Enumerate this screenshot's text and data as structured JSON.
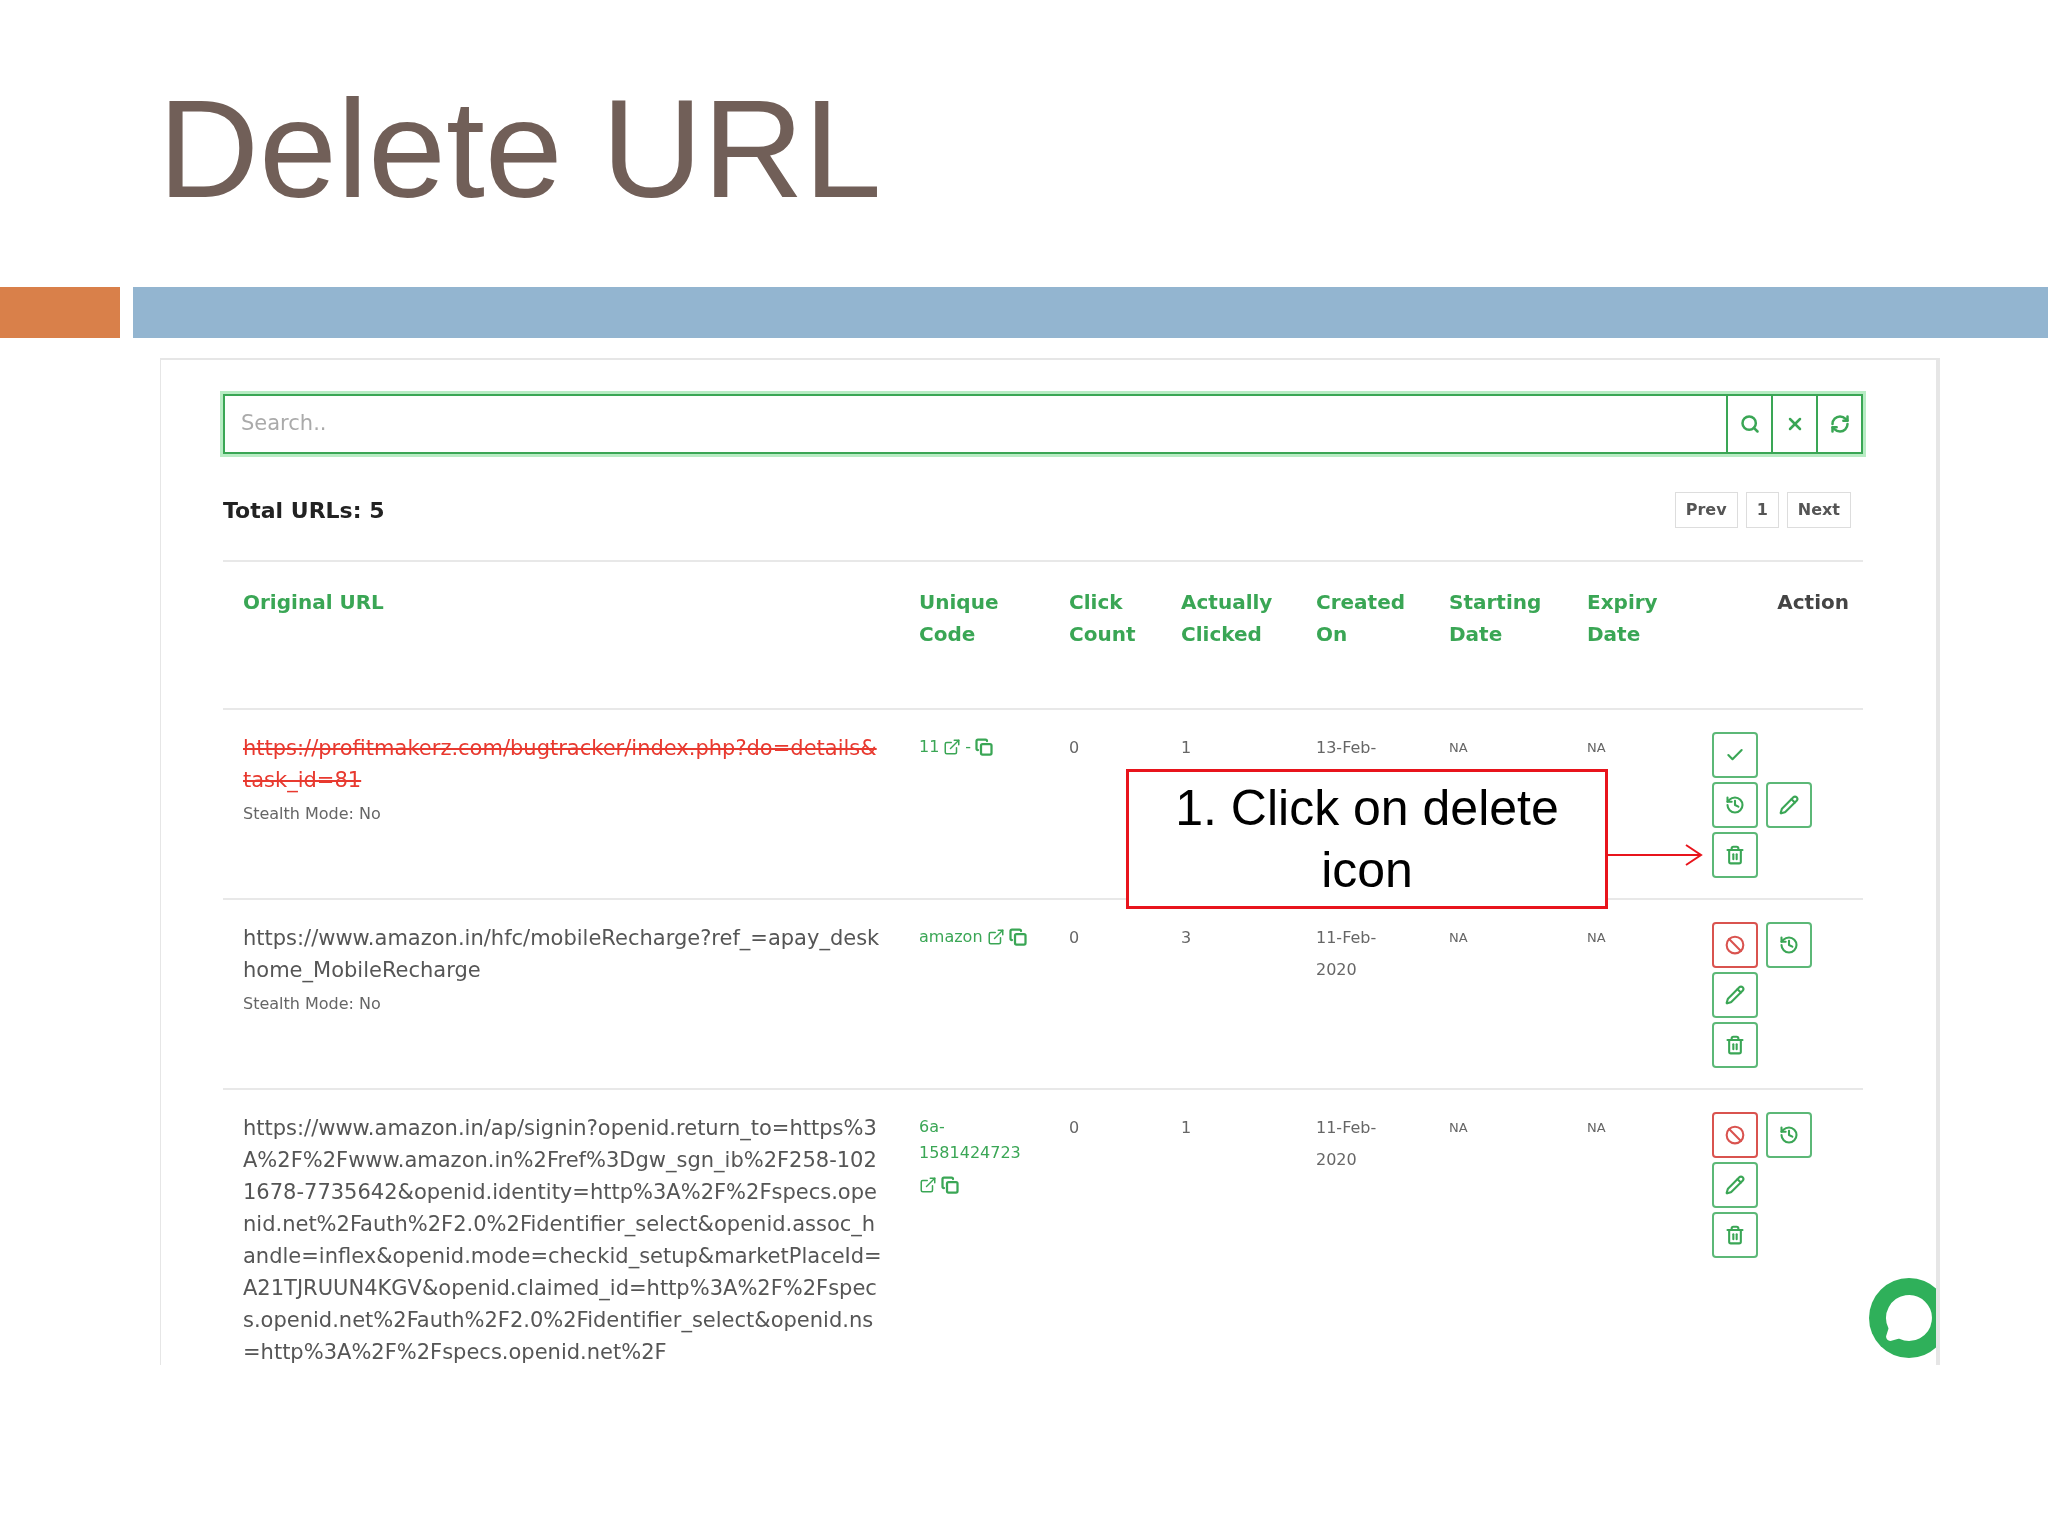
{
  "slide": {
    "title": "Delete URL"
  },
  "app": {
    "search": {
      "placeholder": "Search.."
    },
    "total": "Total URLs: 5",
    "pagination": [
      "Prev",
      "1",
      "Next"
    ],
    "columns": [
      "Original URL",
      "Unique Code",
      "Click Count",
      "Actually Clicked",
      "Created On",
      "Starting Date",
      "Expiry Date",
      "Action"
    ],
    "rows": [
      {
        "url": "https://profitmakerz.com/bugtracker/index.php?do=details&task_id=81",
        "disabled": true,
        "stealth": "Stealth Mode: No",
        "code": "11",
        "separator": "-",
        "clicks": "0",
        "actual": "1",
        "created": "13-Feb-",
        "start": "NA",
        "expiry": "NA",
        "actions": [
          [
            {
              "kind": "enable"
            }
          ],
          [
            {
              "kind": "restore"
            },
            {
              "kind": "edit"
            }
          ],
          [
            {
              "kind": "delete"
            }
          ]
        ]
      },
      {
        "url": "https://www.amazon.in/hfc/mobileRecharge?ref_=apay_deskhome_MobileRecharge",
        "disabled": false,
        "stealth": "Stealth Mode: No",
        "code": "amazon",
        "clicks": "0",
        "actual": "3",
        "created": "11-Feb-2020",
        "start": "NA",
        "expiry": "NA",
        "actions": [
          [
            {
              "kind": "disable"
            },
            {
              "kind": "restore"
            }
          ],
          [
            {
              "kind": "edit"
            }
          ],
          [
            {
              "kind": "delete"
            }
          ]
        ]
      },
      {
        "url": "https://www.amazon.in/ap/signin?openid.return_to=https%3A%2F%2Fwww.amazon.in%2Fref%3Dgw_sgn_ib%2F258-1021678-7735642&openid.identity=http%3A%2F%2Fspecs.openid.net%2Fauth%2F2.0%2Fidentifier_select&openid.assoc_handle=inflex&openid.mode=checkid_setup&marketPlaceId=A21TJRUUN4KGV&openid.claimed_id=http%3A%2F%2Fspecs.openid.net%2Fauth%2F2.0%2Fidentifier_select&openid.ns=http%3A%2F%2Fspecs.openid.net%2F",
        "disabled": false,
        "code": "6a-1581424723",
        "clicks": "0",
        "actual": "1",
        "created": "11-Feb-2020",
        "start": "NA",
        "expiry": "NA",
        "actions": [
          [
            {
              "kind": "disable"
            },
            {
              "kind": "restore"
            }
          ],
          [
            {
              "kind": "edit"
            }
          ],
          [
            {
              "kind": "delete"
            }
          ]
        ]
      }
    ]
  },
  "callout": {
    "text": "1. Click on delete icon"
  }
}
